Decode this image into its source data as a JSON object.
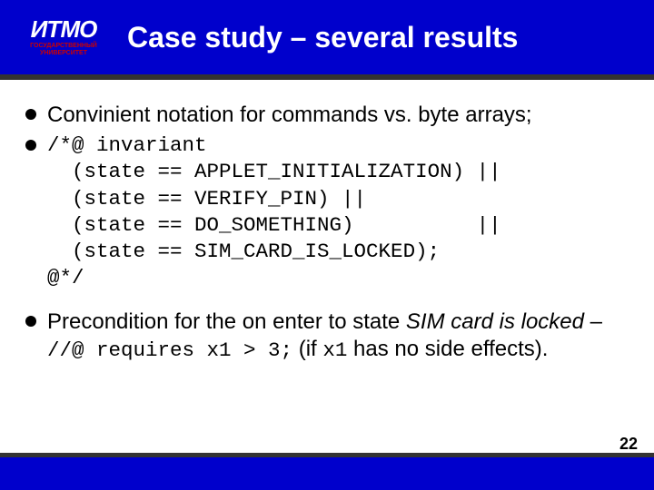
{
  "logo": {
    "main": "ИТМО",
    "sub": "ГОСУДАРСТВЕННЫЙ\nУНИВЕРСИТЕТ"
  },
  "title": "Case study – several results",
  "bullets": {
    "b1": "Convinient notation for commands vs. byte arrays;",
    "b2_code": "/*@ invariant\n  (state == APPLET_INITIALIZATION) ||\n  (state == VERIFY_PIN) ||\n  (state == DO_SOMETHING)          ||\n  (state == SIM_CARD_IS_LOCKED);\n@*/",
    "b3_pre": "Precondition for the on enter to state ",
    "b3_italic": "SIM card is locked",
    "b3_dash": " – ",
    "b3_code": "//@ requires x1 > 3;",
    "b3_if": " (if ",
    "b3_var": "x1",
    "b3_tail": " has no side effects)."
  },
  "page": "22"
}
